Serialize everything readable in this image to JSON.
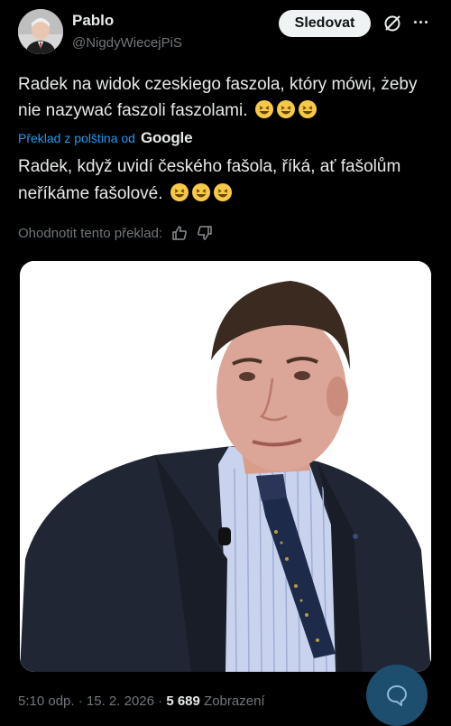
{
  "author": {
    "name": "Pablo",
    "handle": "@NigdyWiecejPiS",
    "avatar_icon": "avatar-portrait"
  },
  "header": {
    "follow_label": "Sledovat",
    "grok_icon": "grok-icon",
    "more_icon": "more-icon"
  },
  "tweet": {
    "text": "Radek na widok czeskiego faszola, który mówi, żeby nie nazywać faszoli faszolami.",
    "emoji": "😆😆😆"
  },
  "translation": {
    "label": "Překlad z polština od",
    "provider": "Google",
    "text": "Radek, když uvidí českého fašola, říká, ať fašolům neříkáme fašolové.",
    "emoji": "😆😆😆"
  },
  "rating": {
    "label": "Ohodnotit tento překlad:"
  },
  "meta": {
    "time": "5:10 odp.",
    "date": "15. 2. 2026",
    "sep": "·",
    "views_count": "5 689",
    "views_label": "Zobrazení"
  },
  "colors": {
    "background": "#000000",
    "text": "#e7e9ea",
    "muted": "#71767b",
    "link": "#1d9bf0",
    "emoji": "#f7c948",
    "fab": "#1d4e6e"
  }
}
